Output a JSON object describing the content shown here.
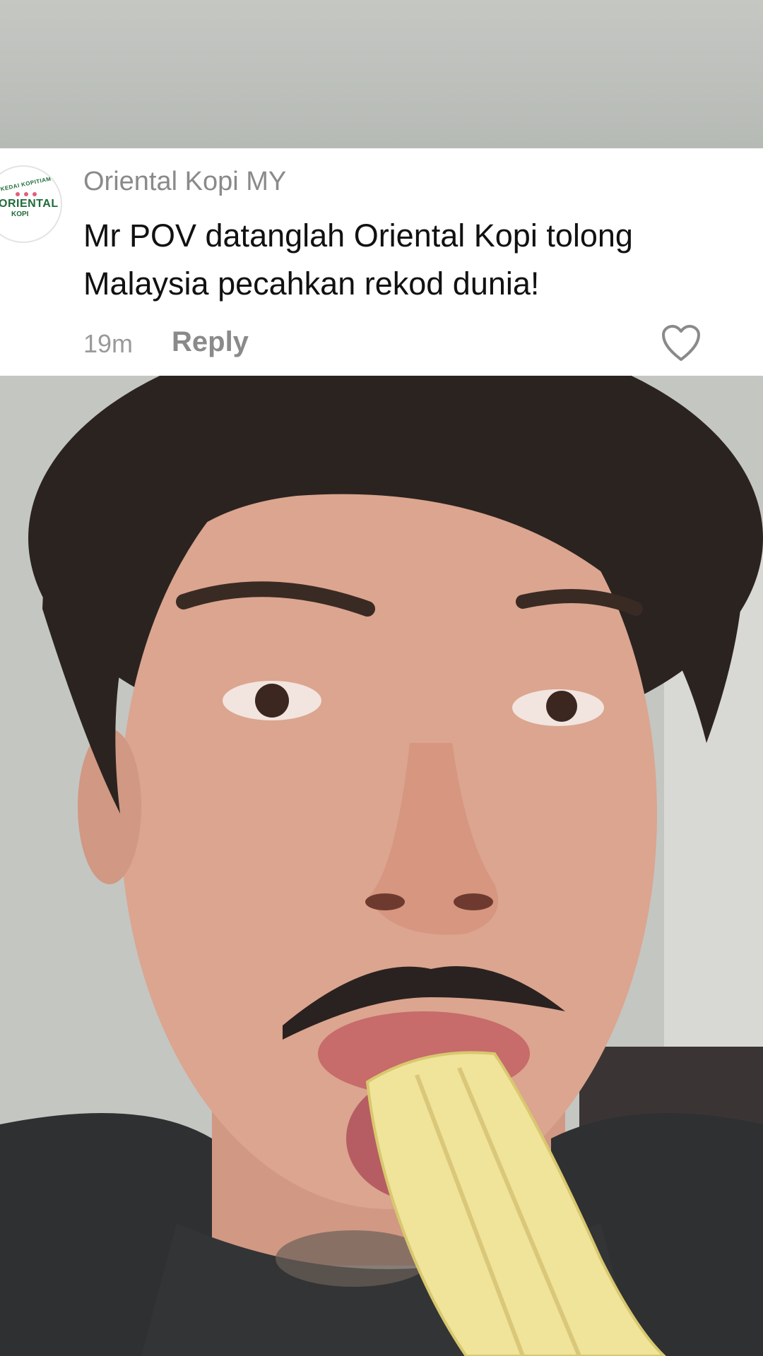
{
  "comment": {
    "author": "Oriental Kopi MY",
    "text": "Mr POV datanglah Oriental Kopi tolong Malaysia pecahkan rekod dunia!",
    "time": "19m",
    "reply_label": "Reply",
    "avatar": {
      "arc_text": "KEDAI KOPITIAM",
      "brand": "ORIENTAL",
      "sub": "KOPI",
      "brand_color": "#1f6b3a"
    },
    "like_icon": "heart-outline-icon"
  },
  "video": {
    "subject": "video-frame"
  }
}
